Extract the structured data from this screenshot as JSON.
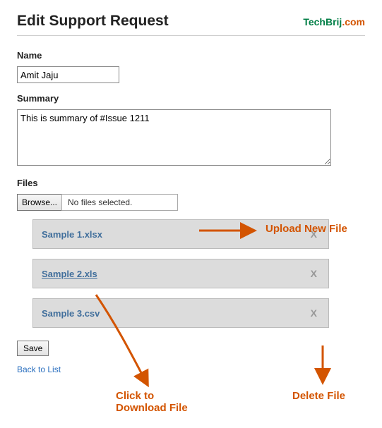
{
  "header": {
    "title": "Edit Support Request",
    "brand_main": "TechBrij",
    "brand_dot": ".com"
  },
  "form": {
    "name_label": "Name",
    "name_value": "Amit Jaju",
    "summary_label": "Summary",
    "summary_value": "This is summary of #Issue 1211",
    "files_label": "Files",
    "browse_label": "Browse...",
    "file_status": "No files selected.",
    "save_label": "Save",
    "back_label": "Back to List"
  },
  "files": [
    {
      "name": "Sample 1.xlsx",
      "delete": "X",
      "underlined": false
    },
    {
      "name": "Sample 2.xls",
      "delete": "X",
      "underlined": true
    },
    {
      "name": "Sample 3.csv",
      "delete": "X",
      "underlined": false
    }
  ],
  "annotations": {
    "upload": "Upload New File",
    "download": "Click to\nDownload File",
    "delete": "Delete File"
  }
}
